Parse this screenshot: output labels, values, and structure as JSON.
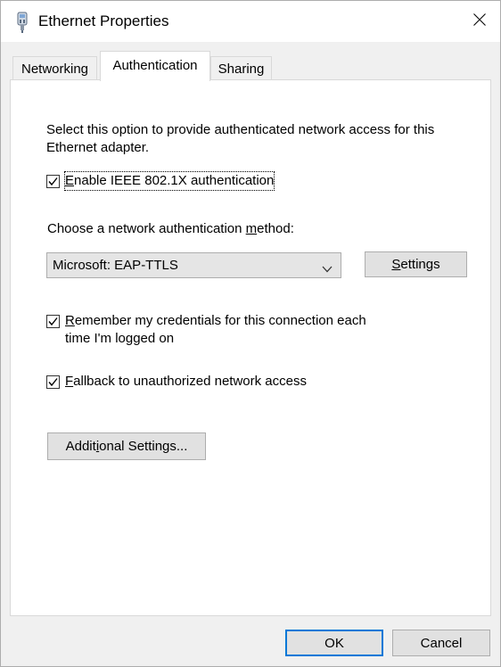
{
  "window": {
    "title": "Ethernet Properties",
    "icons": {
      "app": "network-adapter-icon",
      "close": "close-icon"
    }
  },
  "tabs": [
    {
      "label": "Networking",
      "active": false
    },
    {
      "label": "Authentication",
      "active": true
    },
    {
      "label": "Sharing",
      "active": false
    }
  ],
  "auth": {
    "description": "Select this option to provide authenticated network access for this Ethernet adapter.",
    "enable_8021x": {
      "pre": "",
      "mnemonic": "E",
      "post": "nable IEEE 802.1X authentication",
      "checked": true
    },
    "method_label": {
      "pre": "Choose a network authentication ",
      "mnemonic": "m",
      "post": "ethod:"
    },
    "method_selected": "Microsoft: EAP-TTLS",
    "settings_button": {
      "pre": "",
      "mnemonic": "S",
      "post": "ettings"
    },
    "remember_creds": {
      "pre": "",
      "mnemonic": "R",
      "post": "emember my credentials for this connection each time I'm logged on",
      "checked": true
    },
    "fallback": {
      "pre": "",
      "mnemonic": "F",
      "post": "allback to unauthorized network access",
      "checked": true
    },
    "additional_button": {
      "pre": "Addit",
      "mnemonic": "i",
      "post": "onal Settings..."
    }
  },
  "footer": {
    "ok_label": "OK",
    "cancel_label": "Cancel"
  },
  "colors": {
    "accent": "#0078d7",
    "panel": "#ffffff",
    "window": "#f0f0f0"
  }
}
